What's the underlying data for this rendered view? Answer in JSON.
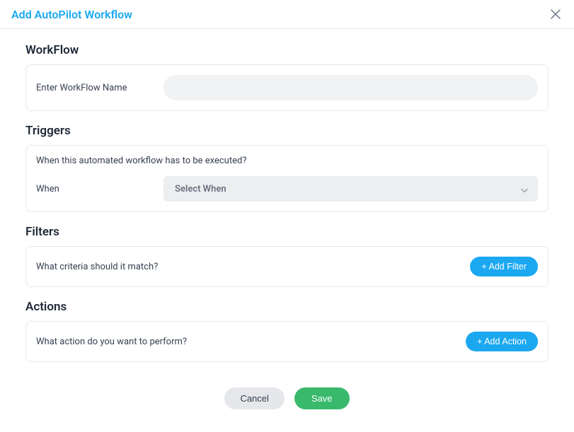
{
  "header": {
    "title": "Add AutoPilot Workflow"
  },
  "workflow": {
    "section_title": "WorkFlow",
    "name_label": "Enter WorkFlow Name",
    "name_value": ""
  },
  "triggers": {
    "section_title": "Triggers",
    "prompt": "When this automated workflow has to be executed?",
    "when_label": "When",
    "select_placeholder": "Select When"
  },
  "filters": {
    "section_title": "Filters",
    "prompt": "What criteria should it match?",
    "add_label": "+ Add Filter"
  },
  "actions": {
    "section_title": "Actions",
    "prompt": "What action do you want to perform?",
    "add_label": "+ Add Action"
  },
  "footer": {
    "cancel": "Cancel",
    "save": "Save"
  }
}
